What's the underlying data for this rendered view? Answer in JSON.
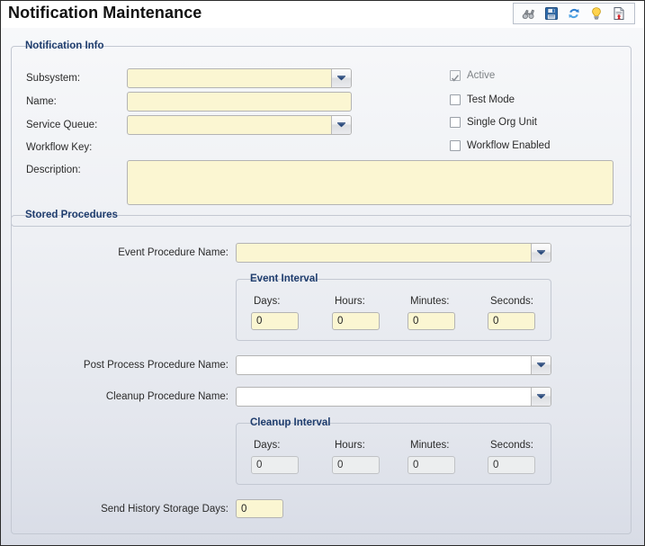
{
  "window": {
    "title": "Notification Maintenance"
  },
  "toolbar": {
    "items": [
      {
        "name": "binoculars-icon",
        "tooltip": "Find"
      },
      {
        "name": "save-icon",
        "tooltip": "Save"
      },
      {
        "name": "refresh-icon",
        "tooltip": "Refresh"
      },
      {
        "name": "lightbulb-icon",
        "tooltip": "Hint"
      },
      {
        "name": "report-icon",
        "tooltip": "Report"
      }
    ]
  },
  "notification_info": {
    "legend": "Notification Info",
    "fields": {
      "subsystem": {
        "label": "Subsystem:",
        "value": "",
        "type": "combobox",
        "enabled": true
      },
      "name": {
        "label": "Name:",
        "value": "",
        "type": "textbox",
        "enabled": true
      },
      "service_queue": {
        "label": "Service Queue:",
        "value": "",
        "type": "combobox",
        "enabled": true
      },
      "workflow_key": {
        "label": "Workflow Key:",
        "value": "",
        "type": "static"
      },
      "description": {
        "label": "Description:",
        "value": "",
        "type": "textarea",
        "enabled": true
      }
    },
    "checkboxes": [
      {
        "label": "Active",
        "checked": true,
        "enabled": false
      },
      {
        "label": "Test Mode",
        "checked": false,
        "enabled": true
      },
      {
        "label": "Single Org Unit",
        "checked": false,
        "enabled": true
      },
      {
        "label": "Workflow Enabled",
        "checked": false,
        "enabled": true
      }
    ]
  },
  "stored_procedures": {
    "legend": "Stored Procedures",
    "event_procedure": {
      "label": "Event Procedure Name:",
      "value": "",
      "enabled": true
    },
    "event_interval": {
      "legend": "Event Interval",
      "enabled": true,
      "fields": [
        {
          "label": "Days:",
          "value": "0"
        },
        {
          "label": "Hours:",
          "value": "0"
        },
        {
          "label": "Minutes:",
          "value": "0"
        },
        {
          "label": "Seconds:",
          "value": "0"
        }
      ]
    },
    "post_process_procedure": {
      "label": "Post Process Procedure Name:",
      "value": "",
      "enabled": false
    },
    "cleanup_procedure": {
      "label": "Cleanup Procedure Name:",
      "value": "",
      "enabled": false
    },
    "cleanup_interval": {
      "legend": "Cleanup Interval",
      "enabled": false,
      "fields": [
        {
          "label": "Days:",
          "value": "0"
        },
        {
          "label": "Hours:",
          "value": "0"
        },
        {
          "label": "Minutes:",
          "value": "0"
        },
        {
          "label": "Seconds:",
          "value": "0"
        }
      ]
    },
    "send_history_storage_days": {
      "label": "Send History Storage Days:",
      "value": "0",
      "enabled": true
    }
  },
  "colors": {
    "editable_field": "#fbf6d2",
    "disabled_field": "#eceeef",
    "legend_text": "#1f3d6e",
    "panel_top": "#f7f8fa",
    "panel_bottom": "#d8dce6",
    "border": "#c3c8d2"
  }
}
